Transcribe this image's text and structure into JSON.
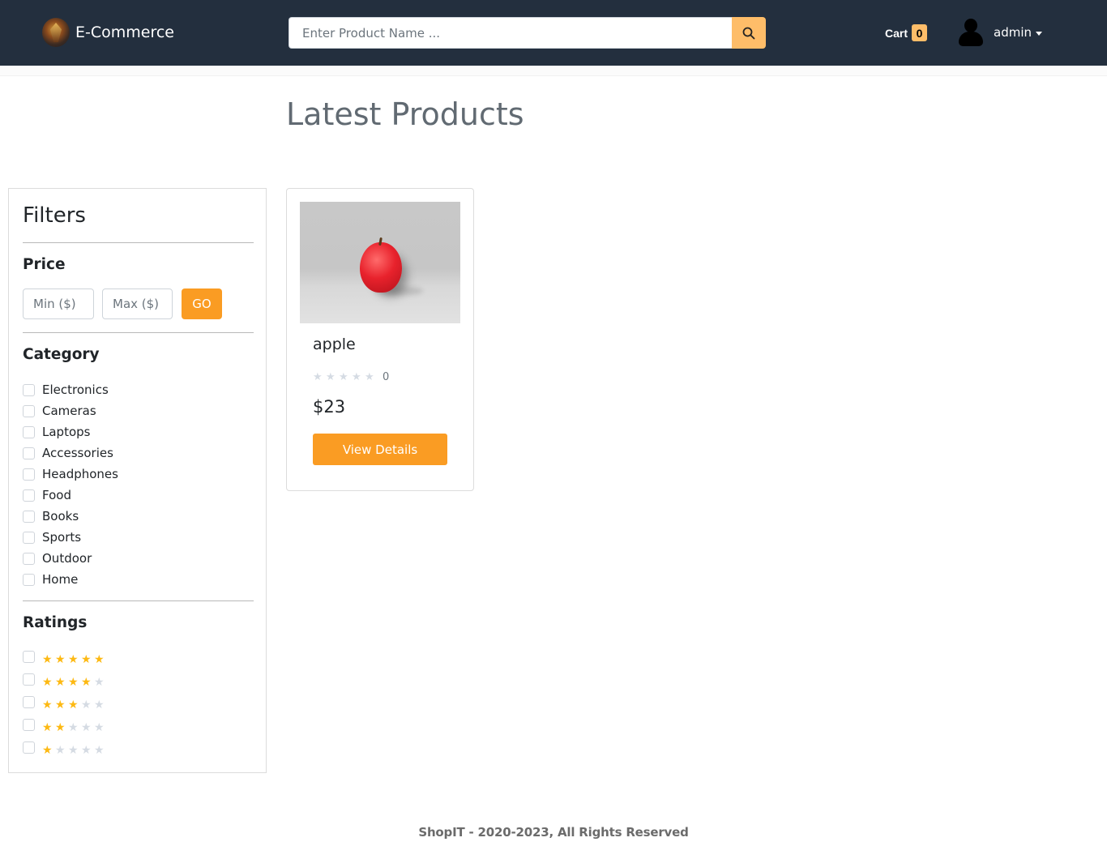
{
  "header": {
    "brand": "E-Commerce",
    "search_placeholder": "Enter Product Name ...",
    "cart_label": "Cart",
    "cart_count": "0",
    "user_name": "admin"
  },
  "main": {
    "title": "Latest Products"
  },
  "filters": {
    "title": "Filters",
    "price": {
      "title": "Price",
      "min_placeholder": "Min ($)",
      "max_placeholder": "Max ($)",
      "go_label": "GO"
    },
    "category": {
      "title": "Category",
      "items": [
        "Electronics",
        "Cameras",
        "Laptops",
        "Accessories",
        "Headphones",
        "Food",
        "Books",
        "Sports",
        "Outdoor",
        "Home"
      ]
    },
    "ratings": {
      "title": "Ratings",
      "items": [
        5,
        4,
        3,
        2,
        1
      ]
    }
  },
  "products": [
    {
      "name": "apple",
      "rating": 0,
      "reviews": "0",
      "price": "$23",
      "button_label": "View Details"
    }
  ],
  "footer": {
    "text": "ShopIT - 2020-2023, All Rights Reserved"
  },
  "colors": {
    "navbar": "#232f3e",
    "accent": "#fa9c23",
    "search_button": "#febd69",
    "star_on": "#fdb913",
    "star_off": "#d5dbe3"
  }
}
